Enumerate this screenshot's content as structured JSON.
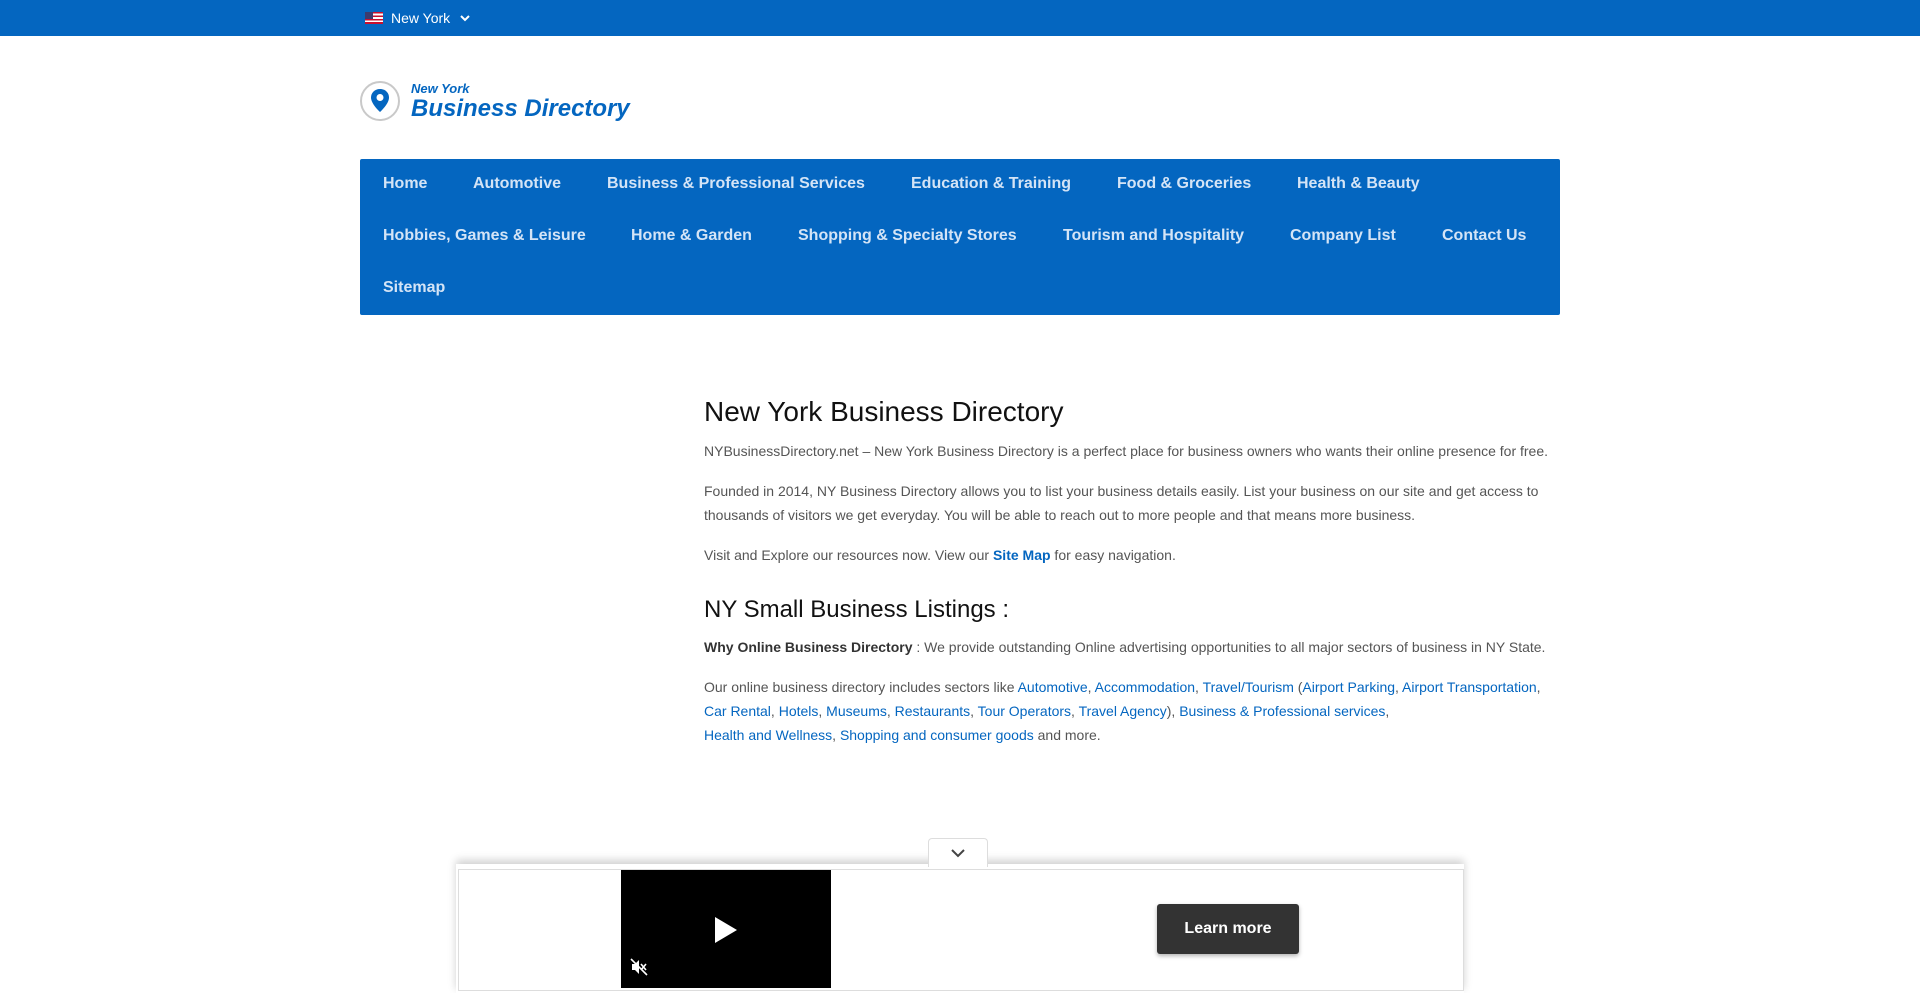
{
  "topbar": {
    "location": "New York",
    "flag_icon": "us-flag-icon",
    "dropdown_icon": "chevron-down-icon"
  },
  "logo": {
    "small": "New York",
    "big": "Business Directory",
    "icon": "map-pin-icon"
  },
  "nav": {
    "items": [
      "Home",
      "Automotive",
      "Business & Professional Services",
      "Education & Training",
      "Food & Groceries",
      "Health & Beauty",
      "Hobbies, Games & Leisure",
      "Home & Garden",
      "Shopping & Specialty Stores",
      "Tourism and Hospitality",
      "Company List",
      "Contact Us",
      "Sitemap"
    ]
  },
  "content": {
    "title": "New York Business Directory",
    "intro": "NYBusinessDirectory.net – New York Business Directory is a perfect place for business owners who wants their online presence for free.",
    "founded": "Founded in 2014, NY Business Directory allows you to list your business details easily. List your business on our site and get access to thousands of visitors we get everyday. You will be able to reach out to more people and that means more business.",
    "visit_pre": "Visit and Explore our resources now. View our ",
    "visit_link": "Site Map",
    "visit_post": " for easy navigation.",
    "subtitle": "NY Small Business Listings :",
    "why_bold": "Why Online Business Directory",
    "why_text": " : We provide outstanding Online advertising opportunities to all major sectors of business in NY State.",
    "sectors_pre": "Our online business directory includes sectors like ",
    "links": {
      "automotive": "Automotive",
      "accommodation": "Accommodation",
      "travel": "Travel/Tourism",
      "airport_parking": "Airport Parking",
      "airport_transportation": "Airport Transportation",
      "car_rental": "Car Rental",
      "hotels": "Hotels",
      "museums": "Museums",
      "restaurants": "Restaurants",
      "tour_operators": "Tour Operators",
      "travel_agency": "Travel Agency",
      "business_services": "Business & Professional services",
      "health": "Health and Wellness",
      "shopping": "Shopping and consumer goods"
    },
    "sectors_post": " and more."
  },
  "ad": {
    "learn_more": "Learn more",
    "collapse_icon": "chevron-down-icon",
    "play_icon": "play-icon",
    "mute_icon": "muted-speaker-icon"
  },
  "colors": {
    "brand_blue": "#0466c0",
    "nav_text": "#d4e4f6",
    "button_dark": "#333333"
  }
}
